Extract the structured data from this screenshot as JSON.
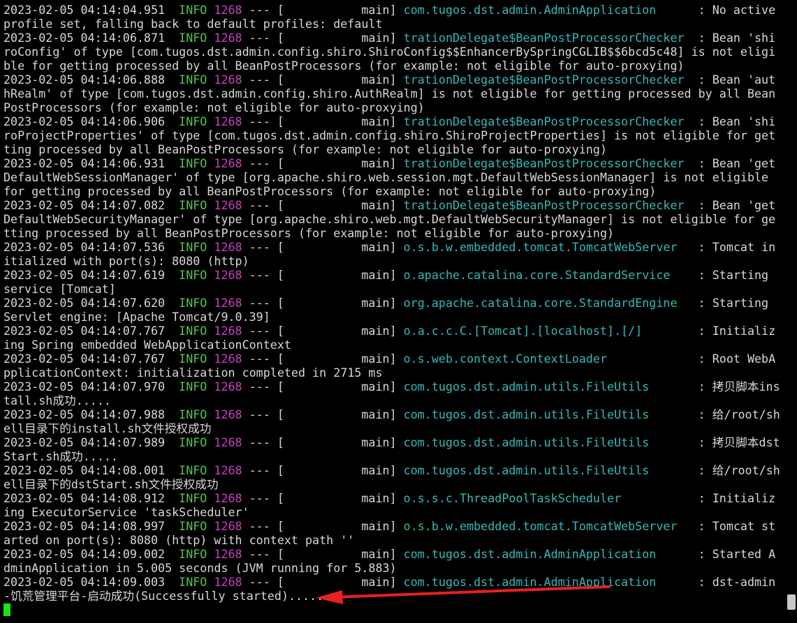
{
  "terminal": {
    "entries": [
      {
        "ts": "2023-02-05 04:14:04.951",
        "level": "INFO",
        "pid": "1268",
        "sep": "---",
        "thread": "[           main]",
        "logger": "com.tugos.dst.admin.AdminApplication     ",
        "msg": ": No active profile set, falling back to default profiles: default"
      },
      {
        "ts": "2023-02-05 04:14:06.871",
        "level": "INFO",
        "pid": "1268",
        "sep": "---",
        "thread": "[           main]",
        "logger": "trationDelegate$BeanPostProcessorChecker ",
        "msg": ": Bean 'shiroConfig' of type [com.tugos.dst.admin.config.shiro.ShiroConfig$$EnhancerBySpringCGLIB$$6bcd5c48] is not eligible for getting processed by all BeanPostProcessors (for example: not eligible for auto-proxying)"
      },
      {
        "ts": "2023-02-05 04:14:06.888",
        "level": "INFO",
        "pid": "1268",
        "sep": "---",
        "thread": "[           main]",
        "logger": "trationDelegate$BeanPostProcessorChecker ",
        "msg": ": Bean 'authRealm' of type [com.tugos.dst.admin.config.shiro.AuthRealm] is not eligible for getting processed by all BeanPostProcessors (for example: not eligible for auto-proxying)"
      },
      {
        "ts": "2023-02-05 04:14:06.906",
        "level": "INFO",
        "pid": "1268",
        "sep": "---",
        "thread": "[           main]",
        "logger": "trationDelegate$BeanPostProcessorChecker ",
        "msg": ": Bean 'shiroProjectProperties' of type [com.tugos.dst.admin.config.shiro.ShiroProjectProperties] is not eligible for getting processed by all BeanPostProcessors (for example: not eligible for auto-proxying)"
      },
      {
        "ts": "2023-02-05 04:14:06.931",
        "level": "INFO",
        "pid": "1268",
        "sep": "---",
        "thread": "[           main]",
        "logger": "trationDelegate$BeanPostProcessorChecker ",
        "msg": ": Bean 'getDefaultWebSessionManager' of type [org.apache.shiro.web.session.mgt.DefaultWebSessionManager] is not eligible for getting processed by all BeanPostProcessors (for example: not eligible for auto-proxying)"
      },
      {
        "ts": "2023-02-05 04:14:07.082",
        "level": "INFO",
        "pid": "1268",
        "sep": "---",
        "thread": "[           main]",
        "logger": "trationDelegate$BeanPostProcessorChecker ",
        "msg": ": Bean 'getDefaultWebSecurityManager' of type [org.apache.shiro.web.mgt.DefaultWebSecurityManager] is not eligible for getting processed by all BeanPostProcessors (for example: not eligible for auto-proxying)"
      },
      {
        "ts": "2023-02-05 04:14:07.536",
        "level": "INFO",
        "pid": "1268",
        "sep": "---",
        "thread": "[           main]",
        "logger": "o.s.b.w.embedded.tomcat.TomcatWebServer  ",
        "msg": ": Tomcat initialized with port(s): 8080 (http)"
      },
      {
        "ts": "2023-02-05 04:14:07.619",
        "level": "INFO",
        "pid": "1268",
        "sep": "---",
        "thread": "[           main]",
        "logger": "o.apache.catalina.core.StandardService   ",
        "msg": ": Starting service [Tomcat]"
      },
      {
        "ts": "2023-02-05 04:14:07.620",
        "level": "INFO",
        "pid": "1268",
        "sep": "---",
        "thread": "[           main]",
        "logger": "org.apache.catalina.core.StandardEngine  ",
        "msg": ": Starting Servlet engine: [Apache Tomcat/9.0.39]"
      },
      {
        "ts": "2023-02-05 04:14:07.767",
        "level": "INFO",
        "pid": "1268",
        "sep": "---",
        "thread": "[           main]",
        "logger": "o.a.c.c.C.[Tomcat].[localhost].[/]       ",
        "msg": ": Initializing Spring embedded WebApplicationContext"
      },
      {
        "ts": "2023-02-05 04:14:07.767",
        "level": "INFO",
        "pid": "1268",
        "sep": "---",
        "thread": "[           main]",
        "logger": "o.s.web.context.ContextLoader            ",
        "msg": ": Root WebApplicationContext: initialization completed in 2715 ms"
      },
      {
        "ts": "2023-02-05 04:14:07.970",
        "level": "INFO",
        "pid": "1268",
        "sep": "---",
        "thread": "[           main]",
        "logger": "com.tugos.dst.admin.utils.FileUtils      ",
        "msg": ": 拷贝脚本install.sh成功....."
      },
      {
        "ts": "2023-02-05 04:14:07.988",
        "level": "INFO",
        "pid": "1268",
        "sep": "---",
        "thread": "[           main]",
        "logger": "com.tugos.dst.admin.utils.FileUtils      ",
        "msg": ": 给/root/shell目录下的install.sh文件授权成功"
      },
      {
        "ts": "2023-02-05 04:14:07.989",
        "level": "INFO",
        "pid": "1268",
        "sep": "---",
        "thread": "[           main]",
        "logger": "com.tugos.dst.admin.utils.FileUtils      ",
        "msg": ": 拷贝脚本dstStart.sh成功....."
      },
      {
        "ts": "2023-02-05 04:14:08.001",
        "level": "INFO",
        "pid": "1268",
        "sep": "---",
        "thread": "[           main]",
        "logger": "com.tugos.dst.admin.utils.FileUtils      ",
        "msg": ": 给/root/shell目录下的dstStart.sh文件授权成功"
      },
      {
        "ts": "2023-02-05 04:14:08.912",
        "level": "INFO",
        "pid": "1268",
        "sep": "---",
        "thread": "[           main]",
        "logger": "o.s.s.c.ThreadPoolTaskScheduler          ",
        "msg": ": Initializing ExecutorService 'taskScheduler'"
      },
      {
        "ts": "2023-02-05 04:14:08.997",
        "level": "INFO",
        "pid": "1268",
        "sep": "---",
        "thread": "[           main]",
        "logger": "o.s.b.w.embedded.tomcat.TomcatWebServer  ",
        "msg": ": Tomcat started on port(s): 8080 (http) with context path ''"
      },
      {
        "ts": "2023-02-05 04:14:09.002",
        "level": "INFO",
        "pid": "1268",
        "sep": "---",
        "thread": "[           main]",
        "logger": "com.tugos.dst.admin.AdminApplication     ",
        "msg": ": Started AdminApplication in 5.005 seconds (JVM running for 5.883)"
      },
      {
        "ts": "2023-02-05 04:14:09.003",
        "level": "INFO",
        "pid": "1268",
        "sep": "---",
        "thread": "[           main]",
        "logger": "com.tugos.dst.admin.AdminApplication     ",
        "msg": ": dst-admin-饥荒管理平台-启动成功(Successfully started)....."
      }
    ]
  },
  "colors": {
    "background": "#000000",
    "text": "#d8d8d8",
    "level": "#54c154",
    "pid": "#cc3fbf",
    "logger": "#36b8b8",
    "cursor": "#17e617",
    "arrow": "#e82020"
  },
  "icons": {
    "cursor": "block-cursor-icon",
    "arrow": "red-arrow-annotation-icon"
  }
}
